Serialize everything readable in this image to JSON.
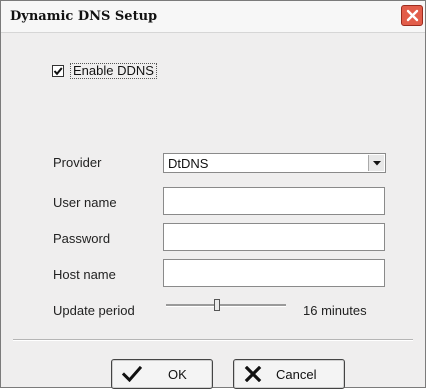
{
  "window": {
    "title": "Dynamic DNS Setup"
  },
  "enable_ddns": {
    "label": "Enable DDNS",
    "checked": true
  },
  "form": {
    "provider_label": "Provider",
    "provider_value": "DtDNS",
    "username_label": "User name",
    "username_value": "",
    "password_label": "Password",
    "password_value": "",
    "hostname_label": "Host name",
    "hostname_value": ""
  },
  "update_period": {
    "label": "Update period",
    "value_text": "16 minutes",
    "slider_fraction": 0.42
  },
  "buttons": {
    "ok_label": "OK",
    "cancel_label": "Cancel"
  },
  "colors": {
    "close_button": "#e25d4a",
    "dialog_bg": "#efeeee"
  }
}
